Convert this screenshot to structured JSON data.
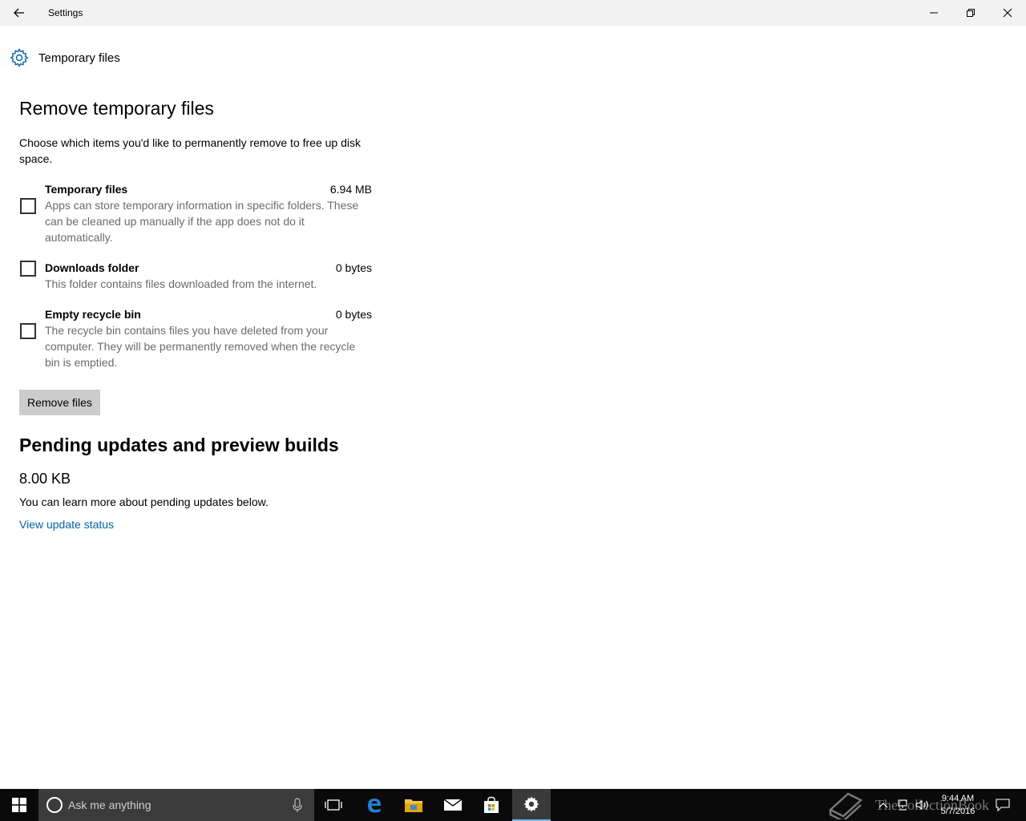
{
  "window": {
    "title": "Settings"
  },
  "page": {
    "header_title": "Temporary files"
  },
  "remove_section": {
    "title": "Remove temporary files",
    "intro": "Choose which items you'd like to permanently remove to free up disk space.",
    "options": [
      {
        "name": "Temporary files",
        "size": "6.94 MB",
        "description": "Apps can store temporary information in specific folders. These can be cleaned up manually if the app does not do it automatically.",
        "checked": false
      },
      {
        "name": "Downloads folder",
        "size": "0 bytes",
        "description": "This folder contains files downloaded from the internet.",
        "checked": false
      },
      {
        "name": "Empty recycle bin",
        "size": "0 bytes",
        "description": "The recycle bin contains files you have deleted from your computer. They will be permanently removed when the recycle bin is emptied.",
        "checked": false
      }
    ],
    "remove_button_label": "Remove files"
  },
  "pending_section": {
    "title": "Pending updates and preview builds",
    "size": "8.00 KB",
    "text": "You can learn more about pending updates below.",
    "link_label": "View update status"
  },
  "taskbar": {
    "search_placeholder": "Ask me anything",
    "time": "9:44 AM",
    "date": "5/7/2016",
    "watermark": "TheCollectionBook"
  },
  "colors": {
    "accent": "#0063b1",
    "link": "#0063b1",
    "button_bg": "#cccccc",
    "titlebar_bg": "#f2f2f2",
    "taskbar_bg": "#0a0a0a",
    "description_text": "#6b6b6b"
  },
  "icons": {
    "back": "arrow-left-icon",
    "page": "gear-icon",
    "minimize": "minimize-icon",
    "maximize": "restore-icon",
    "close": "close-icon"
  }
}
